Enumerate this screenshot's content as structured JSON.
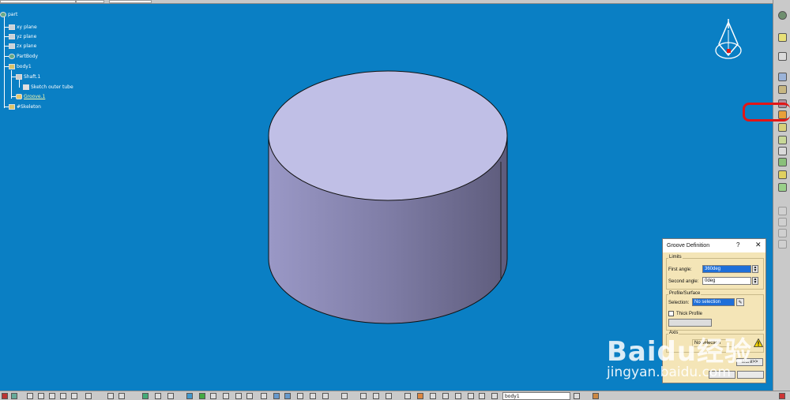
{
  "tree": {
    "root": "part",
    "items": [
      {
        "label": "xy plane"
      },
      {
        "label": "yz plane"
      },
      {
        "label": "zx plane"
      },
      {
        "label": "PartBody"
      },
      {
        "label": "body1"
      },
      {
        "label": "Shaft.1"
      },
      {
        "label": "Sketch outer tube"
      },
      {
        "label": "Groove.1"
      },
      {
        "label": "#Skeleton"
      }
    ]
  },
  "dialog": {
    "title": "Groove Definition",
    "help": "?",
    "close": "✕",
    "limits_label": "Limits",
    "first_angle_label": "First angle:",
    "first_angle_value": "360deg",
    "second_angle_label": "Second angle:",
    "second_angle_value": "0deg",
    "profile_label": "Profile/Surface",
    "selection_label": "Selection:",
    "selection_value": "No selection",
    "thick_profile_label": "Thick Profile",
    "axis_label": "Axis",
    "axis_selection_value": "No selection",
    "more_button": "More>>"
  },
  "watermark": {
    "brand": "Baidu经验",
    "url": "jingyan.baidu.com"
  },
  "bottom_toolbar": {
    "body_field": "body1"
  },
  "colors": {
    "viewport_bg": "#0a7fc4",
    "dialog_bg": "#f4e5b7",
    "highlight": "#e21616",
    "cylinder_top": "#c0bfe6"
  }
}
